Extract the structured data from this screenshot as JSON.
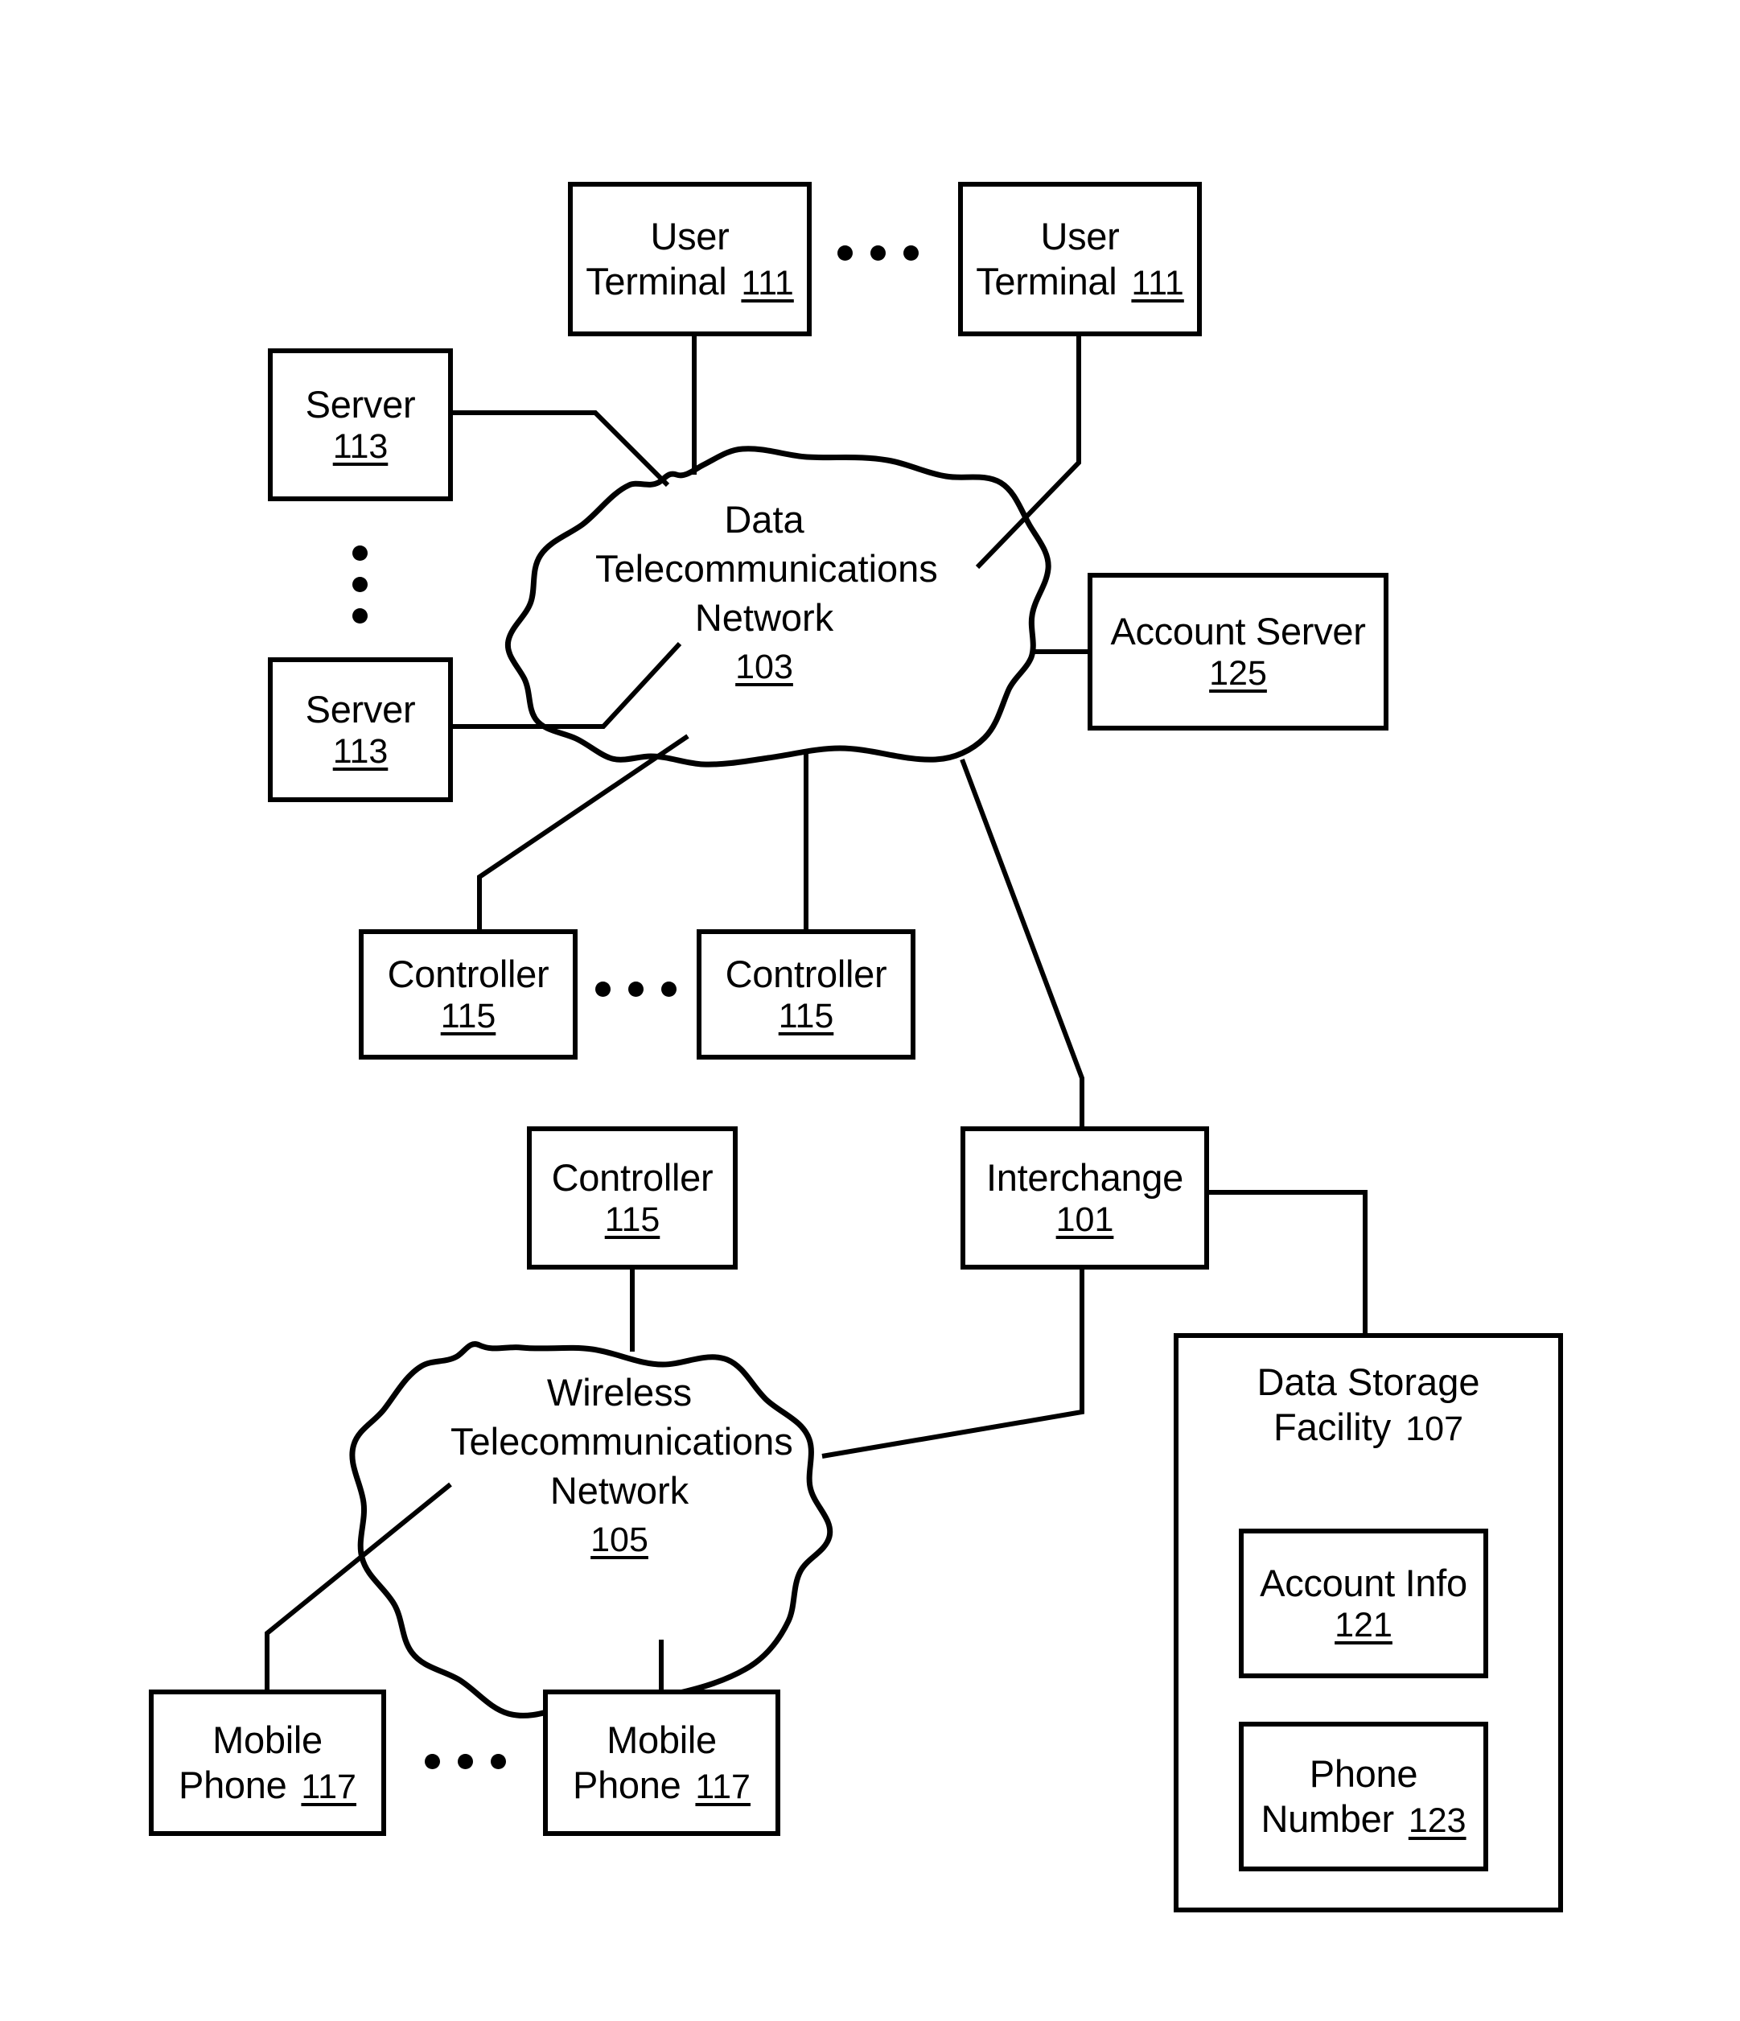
{
  "figure": {
    "type": "patent-network-block-diagram",
    "background_color": "#ffffff",
    "line_color": "#000000"
  },
  "nodes": {
    "user_terminal_left": {
      "label": "User Terminal",
      "line1": "User",
      "line2": "Terminal",
      "ref": "111"
    },
    "user_terminal_right": {
      "label": "User Terminal",
      "line1": "User",
      "line2": "Terminal",
      "ref": "111"
    },
    "server_top": {
      "label": "Server",
      "ref": "113"
    },
    "server_bottom": {
      "label": "Server",
      "ref": "113"
    },
    "data_network": {
      "line1": "Data",
      "line2": "Telecommunications",
      "line3": "Network",
      "ref": "103"
    },
    "account_server": {
      "label": "Account Server",
      "ref": "125"
    },
    "controller_left": {
      "label": "Controller",
      "ref": "115"
    },
    "controller_right": {
      "label": "Controller",
      "ref": "115"
    },
    "controller_lower": {
      "label": "Controller",
      "ref": "115"
    },
    "interchange": {
      "label": "Interchange",
      "ref": "101"
    },
    "wireless_network": {
      "line1": "Wireless",
      "line2": "Telecommunications",
      "line3": "Network",
      "ref": "105"
    },
    "data_storage_facility": {
      "line1": "Data Storage",
      "line2": "Facility",
      "ref": "107"
    },
    "account_info": {
      "label": "Account Info",
      "ref": "121"
    },
    "phone_number": {
      "line1": "Phone",
      "line2": "Number",
      "ref": "123"
    },
    "mobile_phone_left": {
      "line1": "Mobile",
      "line2": "Phone",
      "ref": "117"
    },
    "mobile_phone_right": {
      "line1": "Mobile",
      "line2": "Phone",
      "ref": "117"
    }
  }
}
